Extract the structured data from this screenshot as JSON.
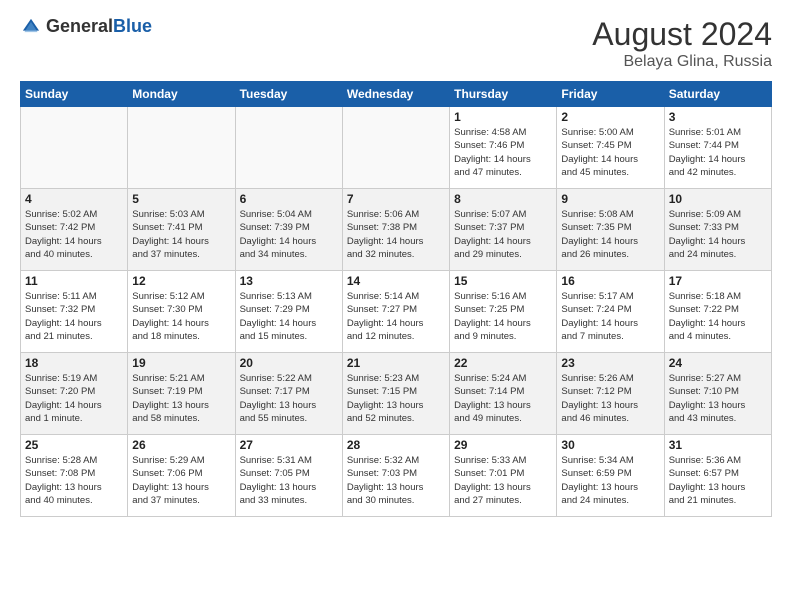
{
  "header": {
    "logo_general": "General",
    "logo_blue": "Blue",
    "main_title": "August 2024",
    "sub_title": "Belaya Glina, Russia"
  },
  "calendar": {
    "days_of_week": [
      "Sunday",
      "Monday",
      "Tuesday",
      "Wednesday",
      "Thursday",
      "Friday",
      "Saturday"
    ],
    "weeks": [
      [
        {
          "day": "",
          "info": ""
        },
        {
          "day": "",
          "info": ""
        },
        {
          "day": "",
          "info": ""
        },
        {
          "day": "",
          "info": ""
        },
        {
          "day": "1",
          "info": "Sunrise: 4:58 AM\nSunset: 7:46 PM\nDaylight: 14 hours\nand 47 minutes."
        },
        {
          "day": "2",
          "info": "Sunrise: 5:00 AM\nSunset: 7:45 PM\nDaylight: 14 hours\nand 45 minutes."
        },
        {
          "day": "3",
          "info": "Sunrise: 5:01 AM\nSunset: 7:44 PM\nDaylight: 14 hours\nand 42 minutes."
        }
      ],
      [
        {
          "day": "4",
          "info": "Sunrise: 5:02 AM\nSunset: 7:42 PM\nDaylight: 14 hours\nand 40 minutes."
        },
        {
          "day": "5",
          "info": "Sunrise: 5:03 AM\nSunset: 7:41 PM\nDaylight: 14 hours\nand 37 minutes."
        },
        {
          "day": "6",
          "info": "Sunrise: 5:04 AM\nSunset: 7:39 PM\nDaylight: 14 hours\nand 34 minutes."
        },
        {
          "day": "7",
          "info": "Sunrise: 5:06 AM\nSunset: 7:38 PM\nDaylight: 14 hours\nand 32 minutes."
        },
        {
          "day": "8",
          "info": "Sunrise: 5:07 AM\nSunset: 7:37 PM\nDaylight: 14 hours\nand 29 minutes."
        },
        {
          "day": "9",
          "info": "Sunrise: 5:08 AM\nSunset: 7:35 PM\nDaylight: 14 hours\nand 26 minutes."
        },
        {
          "day": "10",
          "info": "Sunrise: 5:09 AM\nSunset: 7:33 PM\nDaylight: 14 hours\nand 24 minutes."
        }
      ],
      [
        {
          "day": "11",
          "info": "Sunrise: 5:11 AM\nSunset: 7:32 PM\nDaylight: 14 hours\nand 21 minutes."
        },
        {
          "day": "12",
          "info": "Sunrise: 5:12 AM\nSunset: 7:30 PM\nDaylight: 14 hours\nand 18 minutes."
        },
        {
          "day": "13",
          "info": "Sunrise: 5:13 AM\nSunset: 7:29 PM\nDaylight: 14 hours\nand 15 minutes."
        },
        {
          "day": "14",
          "info": "Sunrise: 5:14 AM\nSunset: 7:27 PM\nDaylight: 14 hours\nand 12 minutes."
        },
        {
          "day": "15",
          "info": "Sunrise: 5:16 AM\nSunset: 7:25 PM\nDaylight: 14 hours\nand 9 minutes."
        },
        {
          "day": "16",
          "info": "Sunrise: 5:17 AM\nSunset: 7:24 PM\nDaylight: 14 hours\nand 7 minutes."
        },
        {
          "day": "17",
          "info": "Sunrise: 5:18 AM\nSunset: 7:22 PM\nDaylight: 14 hours\nand 4 minutes."
        }
      ],
      [
        {
          "day": "18",
          "info": "Sunrise: 5:19 AM\nSunset: 7:20 PM\nDaylight: 14 hours\nand 1 minute."
        },
        {
          "day": "19",
          "info": "Sunrise: 5:21 AM\nSunset: 7:19 PM\nDaylight: 13 hours\nand 58 minutes."
        },
        {
          "day": "20",
          "info": "Sunrise: 5:22 AM\nSunset: 7:17 PM\nDaylight: 13 hours\nand 55 minutes."
        },
        {
          "day": "21",
          "info": "Sunrise: 5:23 AM\nSunset: 7:15 PM\nDaylight: 13 hours\nand 52 minutes."
        },
        {
          "day": "22",
          "info": "Sunrise: 5:24 AM\nSunset: 7:14 PM\nDaylight: 13 hours\nand 49 minutes."
        },
        {
          "day": "23",
          "info": "Sunrise: 5:26 AM\nSunset: 7:12 PM\nDaylight: 13 hours\nand 46 minutes."
        },
        {
          "day": "24",
          "info": "Sunrise: 5:27 AM\nSunset: 7:10 PM\nDaylight: 13 hours\nand 43 minutes."
        }
      ],
      [
        {
          "day": "25",
          "info": "Sunrise: 5:28 AM\nSunset: 7:08 PM\nDaylight: 13 hours\nand 40 minutes."
        },
        {
          "day": "26",
          "info": "Sunrise: 5:29 AM\nSunset: 7:06 PM\nDaylight: 13 hours\nand 37 minutes."
        },
        {
          "day": "27",
          "info": "Sunrise: 5:31 AM\nSunset: 7:05 PM\nDaylight: 13 hours\nand 33 minutes."
        },
        {
          "day": "28",
          "info": "Sunrise: 5:32 AM\nSunset: 7:03 PM\nDaylight: 13 hours\nand 30 minutes."
        },
        {
          "day": "29",
          "info": "Sunrise: 5:33 AM\nSunset: 7:01 PM\nDaylight: 13 hours\nand 27 minutes."
        },
        {
          "day": "30",
          "info": "Sunrise: 5:34 AM\nSunset: 6:59 PM\nDaylight: 13 hours\nand 24 minutes."
        },
        {
          "day": "31",
          "info": "Sunrise: 5:36 AM\nSunset: 6:57 PM\nDaylight: 13 hours\nand 21 minutes."
        }
      ]
    ]
  }
}
